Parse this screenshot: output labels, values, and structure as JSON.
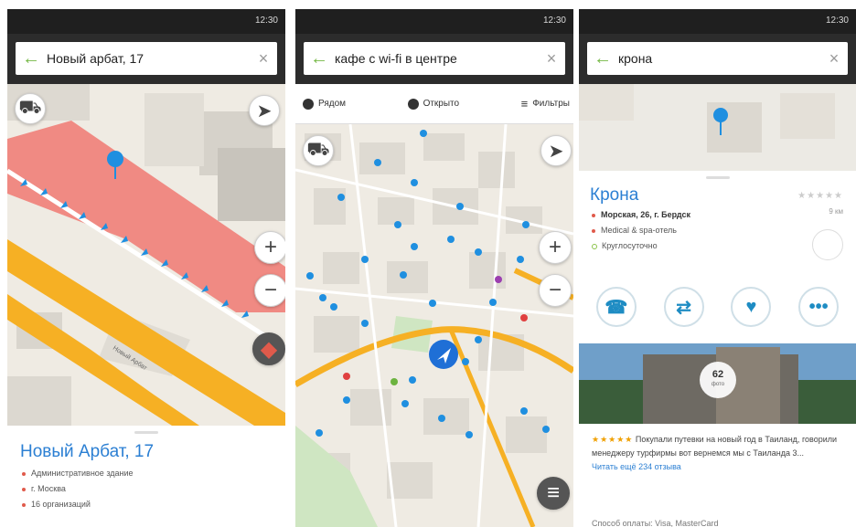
{
  "status_time": "12:30",
  "screens": [
    {
      "search_query": "Новый арбат, 17",
      "card_title": "Новый Арбат, 17",
      "details": [
        "Административное здание",
        "г. Москва",
        "16 организаций"
      ]
    },
    {
      "search_query": "кафе с wi-fi в центре",
      "filters": [
        "Рядом",
        "Открыто",
        "Фильтры"
      ]
    },
    {
      "search_query": "крона",
      "card_title": "Крона",
      "address": "Морская, 26, г. Бердск",
      "category": "Medical & spa-отель",
      "hours": "Круглосуточно",
      "distance": "9 км",
      "rating_badge": "62",
      "rating_badge_caption": "фото",
      "review_text": "Покупали путевки на новый год в Таиланд, говорили менеджеру турфирмы вот вернемся мы с Таиланда 3...",
      "review_link": "Читать ещё 234 отзыва",
      "footer_text": "Способ оплаты: Visa, MasterCard"
    }
  ],
  "icons": {
    "back": "←",
    "clear": "×",
    "zoom_in": "+",
    "zoom_out": "−",
    "locate": "➤",
    "list": "≡",
    "call": "☎",
    "route": "⇄",
    "favorite": "♥",
    "more": "•••",
    "stars": "★★★★★"
  },
  "colors": {
    "accent_blue": "#2b7fd3",
    "back_arrow_green": "#74b844",
    "road_orange": "#f6b024",
    "building_red": "#f08a83",
    "poi_blue": "#1f8fe0",
    "search_bar_bg": "#2c2c2c"
  }
}
